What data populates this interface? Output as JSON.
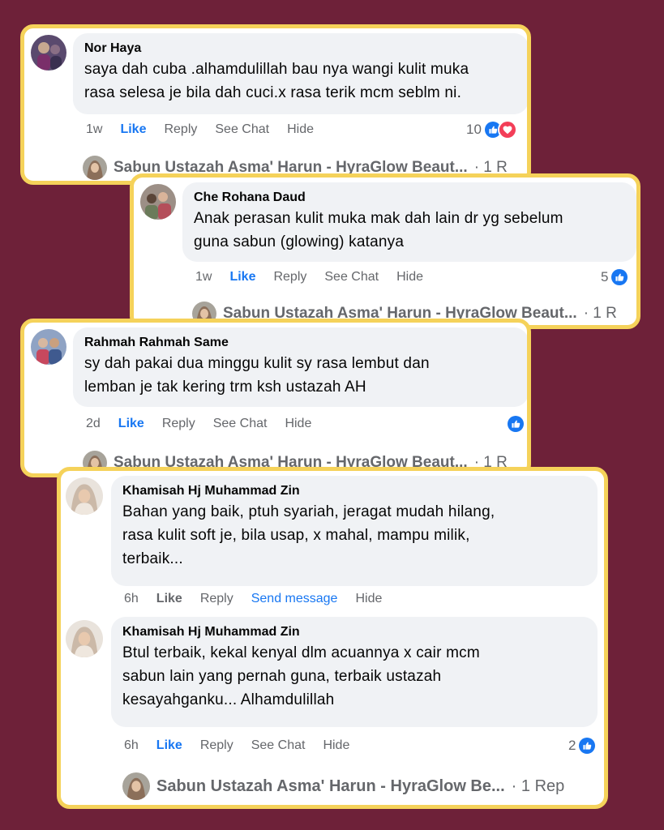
{
  "page_name": "Sabun Ustazah Asma' Harun - HyraGlow Beaut...",
  "page_name_short": "Sabun Ustazah Asma' Harun - HyraGlow Be...",
  "reply_suffix_1": "· 1 R",
  "reply_suffix_2": "· 1 Rep",
  "comments": [
    {
      "name": "Nor Haya",
      "lines": [
        "saya dah cuba .alhamdulillah bau nya wangi kulit muka",
        "rasa selesa je bila dah cuci.x rasa terik mcm seblm ni."
      ],
      "time": "1w",
      "like": "Like",
      "reply": "Reply",
      "chat": "See Chat",
      "hide": "Hide",
      "reaction_count": "10"
    },
    {
      "name": "Che Rohana Daud",
      "lines": [
        "Anak perasan kulit muka mak dah lain dr yg sebelum",
        "guna sabun (glowing) katanya"
      ],
      "time": "1w",
      "like": "Like",
      "reply": "Reply",
      "chat": "See Chat",
      "hide": "Hide",
      "reaction_count": "5"
    },
    {
      "name": "Rahmah Rahmah Same",
      "lines": [
        "sy dah pakai dua minggu kulit sy rasa lembut dan",
        "lemban je tak kering trm ksh ustazah AH"
      ],
      "time": "2d",
      "like": "Like",
      "reply": "Reply",
      "chat": "See Chat",
      "hide": "Hide",
      "reaction_count": ""
    },
    {
      "name": "Khamisah Hj Muhammad Zin",
      "lines": [
        "Bahan yang baik, ptuh syariah, jeragat mudah hilang,",
        "rasa kulit soft je, bila usap, x mahal, mampu milik,",
        "terbaik..."
      ],
      "time": "6h",
      "like": "Like",
      "reply": "Reply",
      "chat": "Send message",
      "hide": "Hide"
    },
    {
      "name": "Khamisah Hj Muhammad Zin",
      "lines": [
        "Btul terbaik, kekal kenyal dlm acuannya x cair mcm",
        "sabun lain yang pernah guna, terbaik ustazah",
        "kesayahganku... Alhamdulillah"
      ],
      "time": "6h",
      "like": "Like",
      "reply": "Reply",
      "chat": "See Chat",
      "hide": "Hide",
      "reaction_count": "2"
    }
  ],
  "colors": {
    "background": "#6e2139",
    "card_border": "#f5d25a",
    "like_blue": "#1877f2",
    "love_red": "#f33e58"
  },
  "icons": [
    "like-icon",
    "love-icon"
  ]
}
